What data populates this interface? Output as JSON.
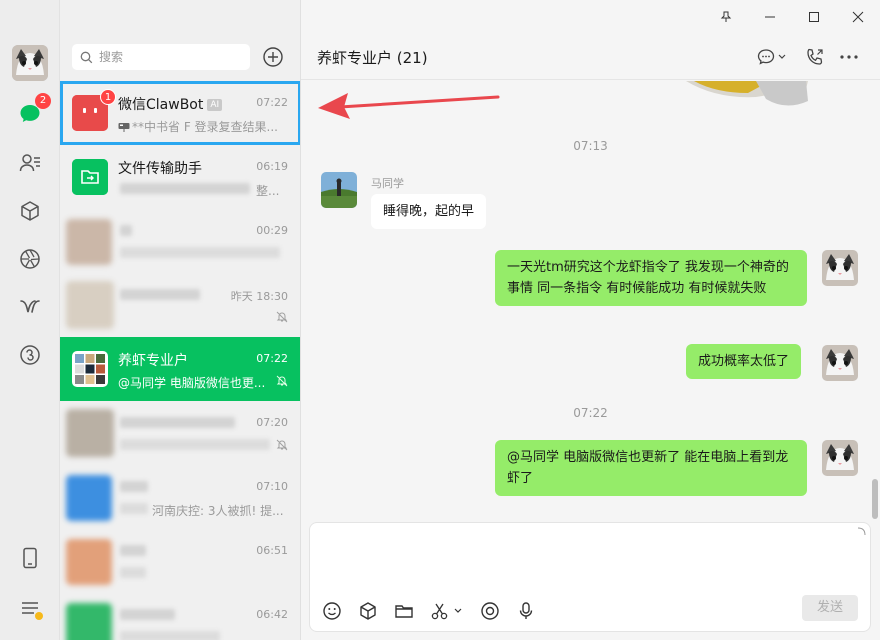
{
  "search": {
    "placeholder": "搜索"
  },
  "rail": {
    "chat_badge": "2"
  },
  "chats": [
    {
      "name": "微信ClawBot",
      "tag": "AI",
      "time": "07:22",
      "preview": "**中书省 F 登录复查结果...",
      "badge": "1"
    },
    {
      "name": "文件传输助手",
      "time": "06:19",
      "preview_tail": "整..."
    },
    {
      "time": "00:29"
    },
    {
      "time": "昨天 18:30"
    },
    {
      "name": "养虾专业户",
      "time": "07:22",
      "preview": "@马同学 电脑版微信也更..."
    },
    {
      "time": "07:20"
    },
    {
      "time": "07:10",
      "preview_tail": "河南庆控: 3人被抓! 提..."
    },
    {
      "time": "06:51"
    },
    {
      "time": "06:42"
    }
  ],
  "conversation": {
    "title": "养虾专业户 (21)",
    "messages": [
      {
        "type": "timestamp",
        "text": "07:13"
      },
      {
        "type": "in",
        "sender": "马同学",
        "text": "睡得晚，起的早"
      },
      {
        "type": "out",
        "text": "一天光tm研究这个龙虾指令了 我发现一个神奇的事情 同一条指令 有时候能成功 有时候就失败"
      },
      {
        "type": "out",
        "text": "成功概率太低了"
      },
      {
        "type": "timestamp",
        "text": "07:22"
      },
      {
        "type": "out",
        "text": "@马同学 电脑版微信也更新了 能在电脑上看到龙虾了"
      }
    ]
  },
  "composer": {
    "send_label": "发送"
  },
  "colors": {
    "accent": "#07c160",
    "bubble_out": "#95ec69",
    "badge": "#ff4444",
    "highlight": "#2aa7f0",
    "arrow": "#e9474d"
  }
}
